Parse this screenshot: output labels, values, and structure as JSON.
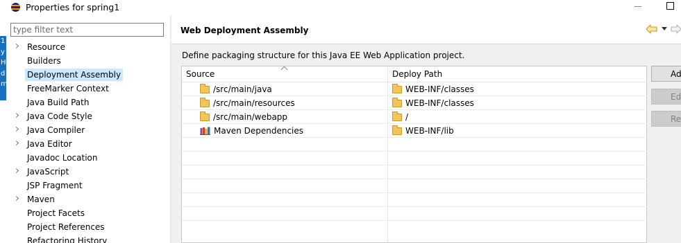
{
  "window": {
    "title": "Properties for spring1"
  },
  "background_strip": {
    "chars": [
      "1",
      "y",
      "H",
      "d",
      "m"
    ]
  },
  "filter": {
    "placeholder": "type filter text"
  },
  "tree": {
    "items": [
      {
        "label": "Resource",
        "expandable": true,
        "selected": false
      },
      {
        "label": "Builders",
        "expandable": false,
        "selected": false
      },
      {
        "label": "Deployment Assembly",
        "expandable": false,
        "selected": true
      },
      {
        "label": "FreeMarker Context",
        "expandable": false,
        "selected": false
      },
      {
        "label": "Java Build Path",
        "expandable": false,
        "selected": false
      },
      {
        "label": "Java Code Style",
        "expandable": true,
        "selected": false
      },
      {
        "label": "Java Compiler",
        "expandable": true,
        "selected": false
      },
      {
        "label": "Java Editor",
        "expandable": true,
        "selected": false
      },
      {
        "label": "Javadoc Location",
        "expandable": false,
        "selected": false
      },
      {
        "label": "JavaScript",
        "expandable": true,
        "selected": false
      },
      {
        "label": "JSP Fragment",
        "expandable": false,
        "selected": false
      },
      {
        "label": "Maven",
        "expandable": true,
        "selected": false
      },
      {
        "label": "Project Facets",
        "expandable": false,
        "selected": false
      },
      {
        "label": "Project References",
        "expandable": false,
        "selected": false
      },
      {
        "label": "Refactoring History",
        "expandable": false,
        "selected": false
      }
    ]
  },
  "page": {
    "title": "Web Deployment Assembly",
    "description": "Define packaging structure for this Java EE Web Application project."
  },
  "table": {
    "columns": {
      "source": "Source",
      "deploy": "Deploy Path"
    },
    "rows": [
      {
        "source": "/src/main/java",
        "source_icon": "folder-icon",
        "deploy": "WEB-INF/classes"
      },
      {
        "source": "/src/main/resources",
        "source_icon": "folder-icon",
        "deploy": "WEB-INF/classes"
      },
      {
        "source": "/src/main/webapp",
        "source_icon": "folder-icon",
        "deploy": "/"
      },
      {
        "source": "Maven Dependencies",
        "source_icon": "library-icon",
        "deploy": "WEB-INF/lib"
      }
    ],
    "empty_rows": 6
  },
  "buttons": {
    "add": "Ad",
    "edit": "Ed",
    "remove": "Ren"
  },
  "colors": {
    "selection": "#cce8ff",
    "folder": "#f2c45a",
    "panel": "#f0f0f0"
  }
}
